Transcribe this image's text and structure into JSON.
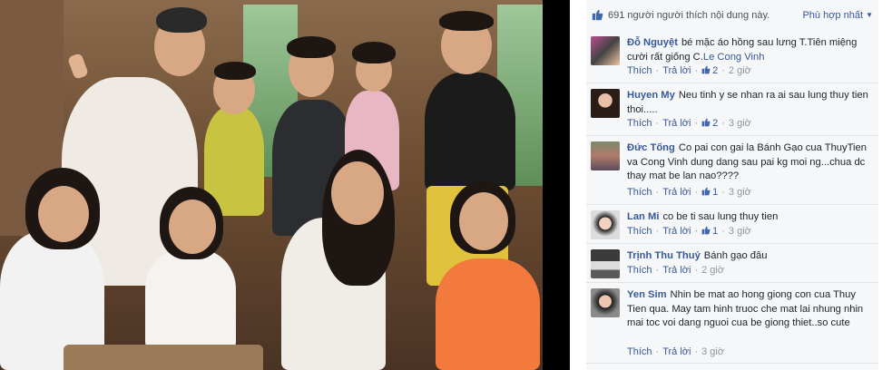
{
  "header": {
    "like_count": "691",
    "like_text": "người người thích nội dung này.",
    "sort_label": "Phù hợp nhất"
  },
  "actions_labels": {
    "like": "Thích",
    "reply": "Trả lời"
  },
  "comments": [
    {
      "author": "Đỗ Nguyệt",
      "text": "bé mặc áo hồng sau lưng T.Tiên miệng cười rất giống C.",
      "mention": "Le Cong Vinh",
      "likes": "2",
      "time": "2 giờ"
    },
    {
      "author": "Huyen My",
      "text": "Neu tinh y se nhan ra ai sau lung thuy tien thoi.....",
      "mention": "",
      "likes": "2",
      "time": "3 giờ"
    },
    {
      "author": "Đức Tống",
      "text": "Co pai con gai la Bánh Gạo cua ThuyTien va Cong Vinh dung dang sau pai kg moi ng...chua dc thay mat be lan nao????",
      "mention": "",
      "likes": "1",
      "time": "3 giờ"
    },
    {
      "author": "Lan Mi",
      "text": "co be ti sau lung thuy tien",
      "mention": "",
      "likes": "1",
      "time": "3 giờ"
    },
    {
      "author": "Trịnh Thu Thuỷ",
      "text": "Bánh gạo đâu",
      "mention": "",
      "likes": "",
      "time": "2 giờ"
    },
    {
      "author": "Yen Sim",
      "text": "Nhin be mat ao hong giong con cua Thuy Tien qua. May tam hinh truoc che mat lai nhung nhin mai toc voi dang nguoi cua be giong thiet..so cute",
      "mention": "",
      "likes": "",
      "time": "3 giờ"
    }
  ],
  "colors": {
    "link": "#365899",
    "panel_bg": "#f6f7f9",
    "text": "#1d2129",
    "meta": "#90949c"
  },
  "icons": [
    "thumbs-up-icon",
    "dropdown-caret-icon",
    "avatar-image"
  ]
}
